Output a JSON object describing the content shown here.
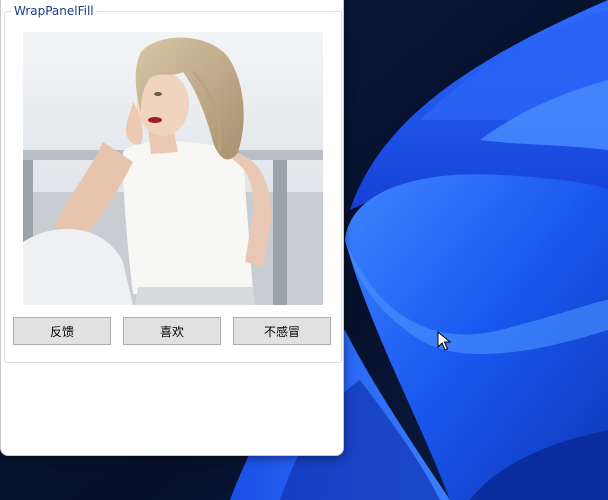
{
  "window": {
    "groupbox_title": "WrapPanelFill"
  },
  "photo": {
    "description_icon": "portrait-photo"
  },
  "buttons": {
    "feedback": "反馈",
    "like": "喜欢",
    "dislike": "不感冒"
  },
  "colors": {
    "groupbox_title": "#1b3c8a",
    "button_bg": "#e1e1e1",
    "wallpaper_dark": "#07122e",
    "wallpaper_blue": "#1f5cf5"
  },
  "icons": {
    "cursor": "mouse-pointer-icon"
  }
}
